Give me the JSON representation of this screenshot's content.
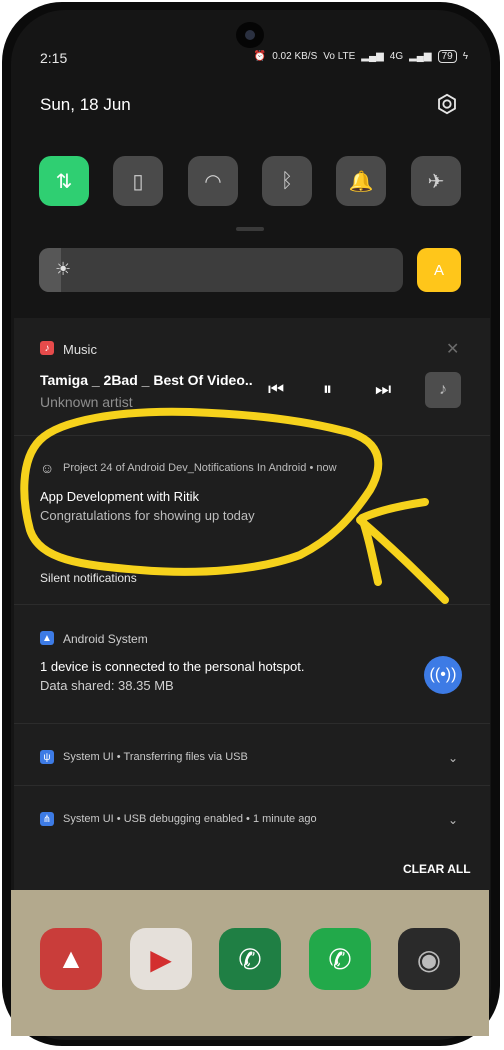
{
  "status_bar": {
    "time": "2:15",
    "net_speed": "0.02 KB/S",
    "vol": "Vo LTE",
    "signal_4g": "4G",
    "battery": "79"
  },
  "header": {
    "date": "Sun, 18 Jun",
    "settings_icon": "gear-icon"
  },
  "quick_tiles": [
    {
      "name": "mobile-data",
      "icon": "mobile-data-icon",
      "glyph": "⇅",
      "active": true
    },
    {
      "name": "flashlight",
      "icon": "flashlight-icon",
      "glyph": "▯",
      "active": false
    },
    {
      "name": "wifi",
      "icon": "wifi-icon",
      "glyph": "◠",
      "active": false
    },
    {
      "name": "bluetooth",
      "icon": "bluetooth-icon",
      "glyph": "ᛒ",
      "active": false
    },
    {
      "name": "sound",
      "icon": "bell-icon",
      "glyph": "🔔",
      "active": false
    },
    {
      "name": "airplane",
      "icon": "airplane-icon",
      "glyph": "✈",
      "active": false
    }
  ],
  "brightness": {
    "level": 0.06,
    "auto_label": "A"
  },
  "music": {
    "app": "Music",
    "track": "Tamiga _ 2Bad _ Best Of Video..",
    "artist": "Unknown artist",
    "accent": "#e64b4b"
  },
  "project_notification": {
    "app": "Project 24 of Android Dev_Notifications In Android",
    "time": "now",
    "title": "App Development with Ritik",
    "text": "Congratulations for showing up today"
  },
  "silent_label": "Silent notifications",
  "android_system": {
    "app": "Android System",
    "title": "1 device is connected to the personal hotspot.",
    "text": "Data shared: 38.35 MB",
    "accent": "#3d7be5"
  },
  "usb_transfer": {
    "app": "System UI",
    "text": "Transferring files via USB"
  },
  "usb_debug": {
    "app": "System UI",
    "text": "USB debugging enabled",
    "time": "1 minute ago"
  },
  "clear_all": "CLEAR ALL",
  "annotation_color": "#f6d21c",
  "dock_apps": [
    {
      "name": "photos",
      "icon": "photos-icon",
      "color": "#c93d3a",
      "glyph": "▲"
    },
    {
      "name": "youtube",
      "icon": "youtube-icon",
      "color": "#e5e0da",
      "glyph": "▶"
    },
    {
      "name": "phone",
      "icon": "phone-icon",
      "color": "#1f7f44",
      "glyph": "✆"
    },
    {
      "name": "whatsapp",
      "icon": "whatsapp-icon",
      "color": "#22a94a",
      "glyph": "✆"
    },
    {
      "name": "camera",
      "icon": "camera-icon",
      "color": "#2a2a2a",
      "glyph": "◉"
    }
  ]
}
